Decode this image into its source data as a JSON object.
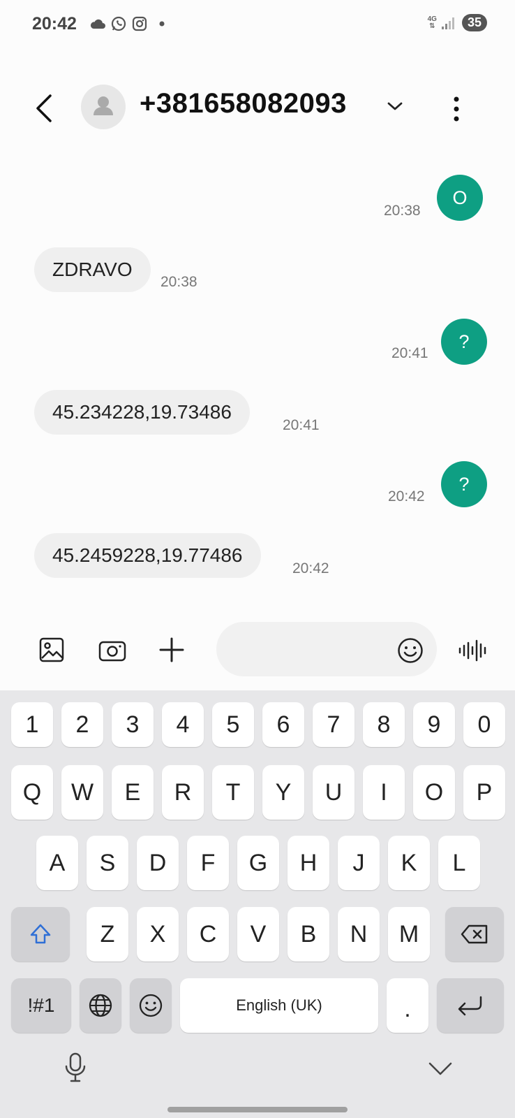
{
  "status_bar": {
    "time": "20:42",
    "network": "4G",
    "battery": "35",
    "notification_icons": [
      "cloud-icon",
      "whatsapp-icon",
      "instagram-icon",
      "dot-icon"
    ]
  },
  "header": {
    "contact": "+381658082093"
  },
  "messages": [
    {
      "dir": "out",
      "text": "O",
      "time": "20:38"
    },
    {
      "dir": "in",
      "text": "ZDRAVO",
      "time": "20:38"
    },
    {
      "dir": "out",
      "text": "?",
      "time": "20:41"
    },
    {
      "dir": "in",
      "text": "45.234228,19.73486",
      "time": "20:41"
    },
    {
      "dir": "out",
      "text": "?",
      "time": "20:42"
    },
    {
      "dir": "in",
      "text": "45.2459228,19.77486",
      "time": "20:42"
    }
  ],
  "composer": {
    "placeholder": ""
  },
  "keyboard": {
    "numbers": [
      "1",
      "2",
      "3",
      "4",
      "5",
      "6",
      "7",
      "8",
      "9",
      "0"
    ],
    "row1": [
      "Q",
      "W",
      "E",
      "R",
      "T",
      "Y",
      "U",
      "I",
      "O",
      "P"
    ],
    "row2": [
      "A",
      "S",
      "D",
      "F",
      "G",
      "H",
      "J",
      "K",
      "L"
    ],
    "row3": [
      "Z",
      "X",
      "C",
      "V",
      "B",
      "N",
      "M"
    ],
    "symbols_label": "!#1",
    "space_label": "English (UK)",
    "period_label": "."
  },
  "colors": {
    "accent": "#0e9f83",
    "incoming_bubble": "#efefef",
    "keyboard_bg": "#e7e7e9"
  }
}
